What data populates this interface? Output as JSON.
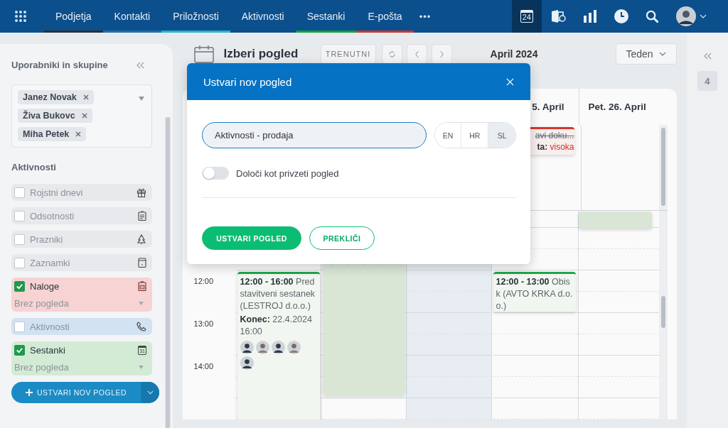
{
  "nav": {
    "items": [
      {
        "label": "Podjetja",
        "selected": false,
        "color": "#2b2f38"
      },
      {
        "label": "Kontakti",
        "selected": false,
        "color": "#1f6fae"
      },
      {
        "label": "Priložnosti",
        "selected": false,
        "color": "#2bb3c9"
      },
      {
        "label": "Aktivnosti",
        "selected": false
      },
      {
        "label": "Sestanki",
        "selected": false,
        "color": "#14a03c"
      },
      {
        "label": "E-pošta",
        "selected": false,
        "color": "#c8372d"
      }
    ],
    "more": "•••",
    "tools": [
      {
        "kind": "calendar",
        "label": "24",
        "selected": true
      },
      {
        "kind": "exchange",
        "selected": false
      },
      {
        "kind": "chart",
        "selected": false
      },
      {
        "kind": "clock",
        "selected": false
      },
      {
        "kind": "search",
        "selected": false
      },
      {
        "kind": "avatar",
        "selected": false
      }
    ]
  },
  "sidebar": {
    "title": "Uporabniki in skupine",
    "users": [
      {
        "name": "Janez Novak"
      },
      {
        "name": "Živa Bukovc"
      },
      {
        "name": "Miha Petek"
      }
    ],
    "section": "Aktivnosti",
    "filters": [
      {
        "label": "Rojstni dnevi",
        "checked": false,
        "color": "#e7e9ec",
        "kind": "gift"
      },
      {
        "label": "Odsotnosti",
        "checked": false,
        "color": "#e7e9ec",
        "kind": "clipboard"
      },
      {
        "label": "Prazniki",
        "checked": false,
        "color": "#e7e9ec",
        "kind": "tree"
      },
      {
        "label": "Zaznamki",
        "checked": false,
        "color": "#e7e9ec",
        "kind": "note"
      },
      {
        "label": "Naloge",
        "checked": true,
        "color": "#f7d3d3",
        "kind": "task",
        "view": "Brez pogleda"
      },
      {
        "label": "Aktivnosti",
        "checked": false,
        "color": "#d2e2f2",
        "kind": "phone"
      },
      {
        "label": "Sestanki",
        "checked": true,
        "color": "#d3ebd5",
        "kind": "calendar",
        "icon_text": "31",
        "view": "Brez pogleda"
      }
    ],
    "create_button": "USTVARI NOV POGLED"
  },
  "toolbar": {
    "view": "Izberi pogled",
    "today": "TRENUTNI",
    "month": "April 2024",
    "range": "Teden"
  },
  "calendar": {
    "columns": [
      {
        "today": false
      },
      {
        "today": false
      },
      {
        "today": true
      },
      {
        "today": false,
        "header": "5. April"
      },
      {
        "today": false,
        "header": "Pet. 26. April"
      }
    ],
    "times": [
      "12:00",
      "13:00",
      "14:00"
    ],
    "events": [
      {
        "color": "#1fa64a",
        "text": "**12:00 - 16:00** Pred stavitveni sestanek (LESTROJ d.o.o.)",
        "end": "**Konec:** 22.4.2024 16:00"
      },
      {
        "color": "#d9e6d6"
      },
      {
        "color": "#d8342a",
        "title": "avi doku...",
        "done": true,
        "priority_label": "ta:",
        "priority": "visoka"
      },
      {
        "color": "#d9e6d6"
      },
      {
        "color": "#1fa64a",
        "text": "**12:00 - 13:00** Obisk (AVTO KRKA d.o.o.)"
      }
    ]
  },
  "right_rail": {
    "count": "4"
  },
  "modal": {
    "title": "Ustvari nov pogled",
    "name_value": "Aktivnosti - prodaja",
    "languages": [
      {
        "label": "EN",
        "selected": false
      },
      {
        "label": "HR",
        "selected": false
      },
      {
        "label": "SL",
        "selected": true
      }
    ],
    "default_toggle": {
      "label": "Določi kot privzeti pogled",
      "on": false
    },
    "buttons": [
      {
        "label": "USTVARI POGLED",
        "kind": "primary"
      },
      {
        "label": "PREKLIČI",
        "kind": "secondary"
      }
    ]
  }
}
